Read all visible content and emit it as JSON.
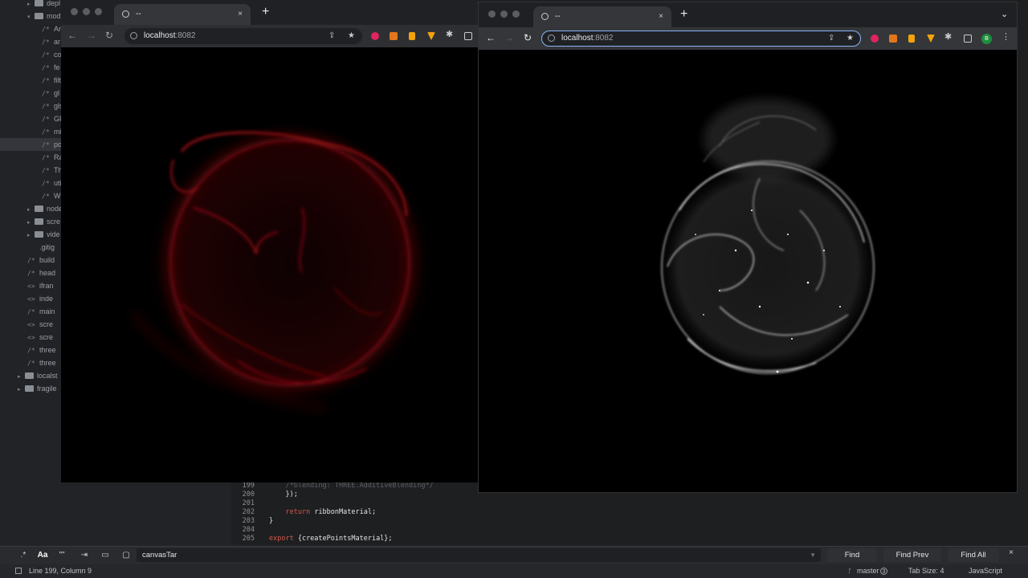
{
  "sidebar": {
    "rows": [
      {
        "glyph": "▸",
        "kind": "folder",
        "label": "depl",
        "indent": 2
      },
      {
        "glyph": "▾",
        "kind": "folder",
        "label": "mod",
        "indent": 2,
        "open": true
      },
      {
        "glyph": "/*",
        "kind": "file",
        "label": "Ar",
        "indent": 3
      },
      {
        "glyph": "/*",
        "kind": "file",
        "label": "ar",
        "indent": 3
      },
      {
        "glyph": "/*",
        "kind": "file",
        "label": "co",
        "indent": 3
      },
      {
        "glyph": "/*",
        "kind": "file",
        "label": "fe",
        "indent": 3
      },
      {
        "glyph": "/*",
        "kind": "file",
        "label": "filt",
        "indent": 3
      },
      {
        "glyph": "/*",
        "kind": "file",
        "label": "gl",
        "indent": 3
      },
      {
        "glyph": "/*",
        "kind": "file",
        "label": "gls",
        "indent": 3
      },
      {
        "glyph": "/*",
        "kind": "file",
        "label": "GF",
        "indent": 3
      },
      {
        "glyph": "/*",
        "kind": "file",
        "label": "mi",
        "indent": 3
      },
      {
        "glyph": "/*",
        "kind": "file",
        "label": "po",
        "indent": 3,
        "selected": true
      },
      {
        "glyph": "/*",
        "kind": "file",
        "label": "Ra",
        "indent": 3
      },
      {
        "glyph": "/*",
        "kind": "file",
        "label": "Th",
        "indent": 3
      },
      {
        "glyph": "/*",
        "kind": "file",
        "label": "uti",
        "indent": 3
      },
      {
        "glyph": "/*",
        "kind": "file",
        "label": "W",
        "indent": 3
      },
      {
        "glyph": "▸",
        "kind": "folder",
        "label": "node",
        "indent": 2
      },
      {
        "glyph": "▸",
        "kind": "folder",
        "label": "scre",
        "indent": 2
      },
      {
        "glyph": "▸",
        "kind": "folder",
        "label": "vide",
        "indent": 2
      },
      {
        "glyph": "",
        "kind": "file-plain",
        "label": ".gitig",
        "indent": 2
      },
      {
        "glyph": "/*",
        "kind": "file",
        "label": "build",
        "indent": 2
      },
      {
        "glyph": "/*",
        "kind": "file",
        "label": "head",
        "indent": 2
      },
      {
        "glyph": "<>",
        "kind": "file",
        "label": "ifran",
        "indent": 2
      },
      {
        "glyph": "<>",
        "kind": "file",
        "label": "inde",
        "indent": 2
      },
      {
        "glyph": "/*",
        "kind": "file",
        "label": "main",
        "indent": 2
      },
      {
        "glyph": "<>",
        "kind": "file",
        "label": "scre",
        "indent": 2
      },
      {
        "glyph": "<>",
        "kind": "file",
        "label": "scre",
        "indent": 2
      },
      {
        "glyph": "/*",
        "kind": "file",
        "label": "three",
        "indent": 2
      },
      {
        "glyph": "/*",
        "kind": "file",
        "label": "three",
        "indent": 2
      },
      {
        "glyph": "▸",
        "kind": "folder",
        "label": "localst",
        "indent": 1
      },
      {
        "glyph": "▸",
        "kind": "folder",
        "label": "fragile",
        "indent": 1
      }
    ]
  },
  "code": {
    "lines": [
      {
        "n": "199",
        "text": "    /*blending: THREE.AdditiveBlending*/",
        "style": "comment"
      },
      {
        "n": "200",
        "text": "    });",
        "style": "plain"
      },
      {
        "n": "201",
        "text": "",
        "style": "plain"
      },
      {
        "n": "202",
        "kw": "return",
        "text": " ribbonMaterial;",
        "indent": "    ",
        "style": "kw"
      },
      {
        "n": "203",
        "text": "}",
        "style": "plain"
      },
      {
        "n": "204",
        "text": "",
        "style": "plain"
      },
      {
        "n": "205",
        "kw": "export",
        "text": " {createPointsMaterial};",
        "indent": "",
        "style": "kw"
      }
    ]
  },
  "findbar": {
    "toggles": [
      ".*",
      "Aa",
      "\"\"",
      "⇥",
      "▭",
      "▢"
    ],
    "query": "canvasTar",
    "find_label": "Find",
    "find_prev_label": "Find Prev",
    "find_all_label": "Find All",
    "close": "×"
  },
  "statusbar": {
    "position": "Line 199, Column 9",
    "branch": "master",
    "branch_count": "3",
    "tab_size": "Tab Size: 4",
    "language": "JavaScript"
  },
  "browser_left": {
    "tab_title": "--",
    "url_host": "localhost",
    "url_port": ":8082",
    "render_color": "#c4141e"
  },
  "browser_right": {
    "tab_title": "--",
    "url_host": "localhost",
    "url_port": ":8082",
    "profile_initial": "B",
    "render_color": "#e6e6e6"
  },
  "icons": {
    "back": "←",
    "forward": "→",
    "reload": "↻",
    "share": "⇪",
    "star": "★",
    "extensions": "✱",
    "menu": "⋮",
    "new_tab": "+",
    "close_tab": "×",
    "chevron": "⌄"
  }
}
